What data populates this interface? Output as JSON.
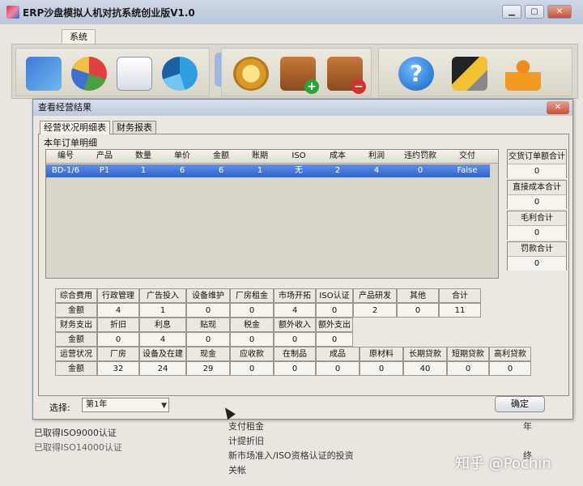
{
  "window": {
    "title": "ERP沙盘模拟人机对抗系统创业版V1.0",
    "buttons": {
      "minimize": "▁",
      "maximize": "▢",
      "close": "✕"
    }
  },
  "ribbon": {
    "tab_label": "系统"
  },
  "toolbar": {
    "icons": [
      "analysis-chart-icon",
      "pie-chart-icon",
      "report-document-icon",
      "pie-chart-icon",
      "sun-spotlight-icon",
      "coins-icon",
      "add-box-icon",
      "remove-box-icon",
      "help-icon",
      "tools-icon",
      "person-icon"
    ],
    "help_glyph": "?"
  },
  "behind": {
    "left_lines": [
      "已取得ISO9000认证",
      "已取得ISO14000认证"
    ],
    "center_lines": [
      "支付租金",
      "计提折旧",
      "新市场准入/ISO资格认证的投资",
      "关帐"
    ],
    "right_lines": [
      "年",
      "终"
    ]
  },
  "watermark": "知乎 @Pochin",
  "dialog": {
    "title": "查看经营结果",
    "close": "✕",
    "tabs": [
      "经营状况明细表",
      "财务报表"
    ],
    "orders_section_label": "本年订单明细",
    "orders": {
      "headers": [
        "编号",
        "产品",
        "数量",
        "单价",
        "金额",
        "账期",
        "ISO",
        "成本",
        "利润",
        "违约罚款",
        "交付"
      ],
      "rows": [
        [
          "BD-1/6",
          "P1",
          "1",
          "6",
          "6",
          "1",
          "无",
          "2",
          "4",
          "0",
          "False"
        ]
      ]
    },
    "summary": [
      {
        "label": "交货订单额合计",
        "value": "0"
      },
      {
        "label": "直接成本合计",
        "value": "0"
      },
      {
        "label": "毛利合计",
        "value": "0"
      },
      {
        "label": "罚款合计",
        "value": "0"
      }
    ],
    "expenses": {
      "header": [
        "综合费用",
        "行政管理",
        "广告投入",
        "设备维护",
        "厂房租金",
        "市场开拓",
        "ISO认证",
        "产品研发",
        "其他",
        "合计"
      ],
      "values": [
        "金额",
        "4",
        "1",
        "0",
        "0",
        "4",
        "0",
        "2",
        "0",
        "11"
      ]
    },
    "financial": {
      "header": [
        "财务支出",
        "折旧",
        "利息",
        "贴现",
        "税金",
        "额外收入",
        "额外支出"
      ],
      "values": [
        "金额",
        "0",
        "4",
        "0",
        "0",
        "0",
        "0"
      ]
    },
    "operations": {
      "header": [
        "运营状况",
        "厂房",
        "设备及在建",
        "现金",
        "应收款",
        "在制品",
        "成品",
        "原材料",
        "长期贷款",
        "短期贷款",
        "高利贷款"
      ],
      "values": [
        "金额",
        "32",
        "24",
        "29",
        "0",
        "0",
        "0",
        "0",
        "40",
        "0",
        "0"
      ]
    },
    "footer": {
      "select_label": "选择:",
      "select_value": "第1年",
      "ok_label": "确定"
    }
  }
}
